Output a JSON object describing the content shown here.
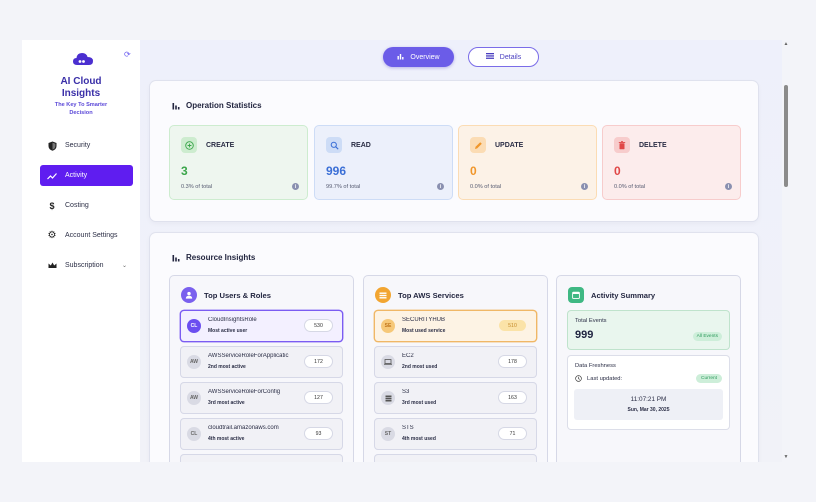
{
  "brand": {
    "title": "AI Cloud Insights",
    "subtitle": "The Key To Smarter Decision"
  },
  "nav": [
    {
      "label": "Security",
      "icon": "shield-icon"
    },
    {
      "label": "Activity",
      "icon": "trend-icon",
      "active": true
    },
    {
      "label": "Costing",
      "icon": "dollar-icon"
    },
    {
      "label": "Account Settings",
      "icon": "gear-icon"
    },
    {
      "label": "Subscription",
      "icon": "crown-icon",
      "has_chevron": true
    }
  ],
  "tabs": {
    "overview": "Overview",
    "details": "Details"
  },
  "operation": {
    "title": "Operation Statistics",
    "stats": [
      {
        "label": "CREATE",
        "value": "3",
        "pct": "0.3% of total",
        "accent": "#3aa54a",
        "bg": "#eef6ef",
        "icon_bg": "#cdeccf",
        "icon": "plus-circle-icon"
      },
      {
        "label": "READ",
        "value": "996",
        "pct": "99.7% of total",
        "accent": "#3b6fd6",
        "bg": "#ecf0fb",
        "icon_bg": "#cddcf6",
        "icon": "search-icon"
      },
      {
        "label": "UPDATE",
        "value": "0",
        "pct": "0.0% of total",
        "accent": "#f0962a",
        "bg": "#fcf2e7",
        "icon_bg": "#fbdcb4",
        "icon": "pencil-icon"
      },
      {
        "label": "DELETE",
        "value": "0",
        "pct": "0.0% of total",
        "accent": "#e04646",
        "bg": "#fcecec",
        "icon_bg": "#f7cccc",
        "icon": "trash-icon"
      }
    ]
  },
  "resource": {
    "title": "Resource Insights",
    "users": {
      "title": "Top Users & Roles",
      "rows": [
        {
          "initials": "CL",
          "name": "CloudInsightsRole",
          "sub": "Most active user",
          "count": "530"
        },
        {
          "initials": "AW",
          "name": "AWSServiceRoleForApplicatic",
          "sub": "2nd most active",
          "count": "172"
        },
        {
          "initials": "AW",
          "name": "AWSServiceRoleForConfig",
          "sub": "3rd most active",
          "count": "127"
        },
        {
          "initials": "CL",
          "name": "cloudtrail.amazonaws.com",
          "sub": "4th most active",
          "count": "93"
        }
      ]
    },
    "services": {
      "title": "Top AWS Services",
      "rows": [
        {
          "initials": "SE",
          "name": "SECURITYHUB",
          "sub": "Most used service",
          "count": "510"
        },
        {
          "initials": "EC2",
          "name": "EC2",
          "sub": "2nd most used",
          "count": "178"
        },
        {
          "initials": "S3",
          "name": "S3",
          "sub": "3rd most used",
          "count": "163"
        },
        {
          "initials": "ST",
          "name": "STS",
          "sub": "4th most used",
          "count": "71"
        }
      ]
    },
    "summary": {
      "title": "Activity Summary",
      "total_label": "Total Events",
      "total_value": "999",
      "total_badge": "All Events",
      "freshness_title": "Data Freshness",
      "last_updated_label": "Last updated:",
      "current_badge": "Current",
      "time": "11:07:21 PM",
      "date": "Sun, Mar 30, 2025"
    }
  },
  "colors": {
    "accent": "#5f1df0",
    "primary_tab": "#6b5ce8"
  }
}
